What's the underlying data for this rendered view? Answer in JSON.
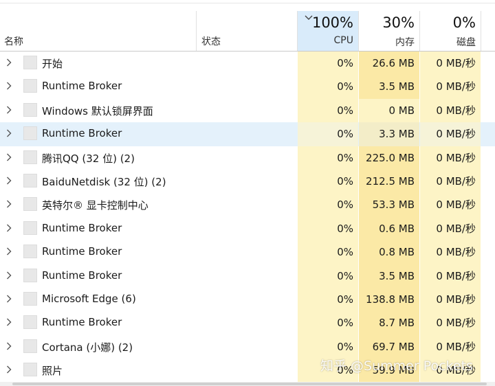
{
  "header": {
    "name_label": "名称",
    "status_label": "状态",
    "cpu": {
      "percent": "100%",
      "label": "CPU",
      "sort_icon": "chevron-down-icon"
    },
    "memory": {
      "percent": "30%",
      "label": "内存"
    },
    "disk": {
      "percent": "0%",
      "label": "磁盘"
    }
  },
  "processes": [
    {
      "name": "开始",
      "cpu": "0%",
      "memory": "26.6 MB",
      "disk": "0 MB/秒",
      "memory_level": "high"
    },
    {
      "name": "Runtime Broker",
      "cpu": "0%",
      "memory": "3.5 MB",
      "disk": "0 MB/秒",
      "memory_level": "high"
    },
    {
      "name": "Windows 默认锁屏界面",
      "cpu": "0%",
      "memory": "0 MB",
      "disk": "0 MB/秒",
      "memory_level": "low"
    },
    {
      "name": "Runtime Broker",
      "cpu": "0%",
      "memory": "3.3 MB",
      "disk": "0 MB/秒",
      "memory_level": "high",
      "selected": true
    },
    {
      "name": "腾讯QQ (32 位) (2)",
      "cpu": "0%",
      "memory": "225.0 MB",
      "disk": "0 MB/秒",
      "memory_level": "high"
    },
    {
      "name": "BaiduNetdisk (32 位) (2)",
      "cpu": "0%",
      "memory": "212.5 MB",
      "disk": "0 MB/秒",
      "memory_level": "high"
    },
    {
      "name": "英特尔® 显卡控制中心",
      "cpu": "0%",
      "memory": "53.3 MB",
      "disk": "0 MB/秒",
      "memory_level": "high"
    },
    {
      "name": "Runtime Broker",
      "cpu": "0%",
      "memory": "0.6 MB",
      "disk": "0 MB/秒",
      "memory_level": "high"
    },
    {
      "name": "Runtime Broker",
      "cpu": "0%",
      "memory": "0.8 MB",
      "disk": "0 MB/秒",
      "memory_level": "high"
    },
    {
      "name": "Runtime Broker",
      "cpu": "0%",
      "memory": "3.5 MB",
      "disk": "0 MB/秒",
      "memory_level": "high"
    },
    {
      "name": "Microsoft Edge (6)",
      "cpu": "0%",
      "memory": "138.8 MB",
      "disk": "0 MB/秒",
      "memory_level": "high"
    },
    {
      "name": "Runtime Broker",
      "cpu": "0%",
      "memory": "8.7 MB",
      "disk": "0 MB/秒",
      "memory_level": "high"
    },
    {
      "name": "Cortana (小娜) (2)",
      "cpu": "0%",
      "memory": "69.7 MB",
      "disk": "0 MB/秒",
      "memory_level": "high"
    },
    {
      "name": "照片",
      "cpu": "0%",
      "memory": "59.9 MB",
      "disk": "0 MB/秒",
      "memory_level": "high"
    }
  ],
  "icons": {
    "expander": "chevron-right-icon",
    "app": "app-icon"
  },
  "watermark": "知乎 @Summer Pockets",
  "colors": {
    "cpu_header_bg": "#d9ebfa",
    "heat_light": "#fdf4c6",
    "heat_medium": "#fbe9a6",
    "selection": "#e4f1fb"
  }
}
